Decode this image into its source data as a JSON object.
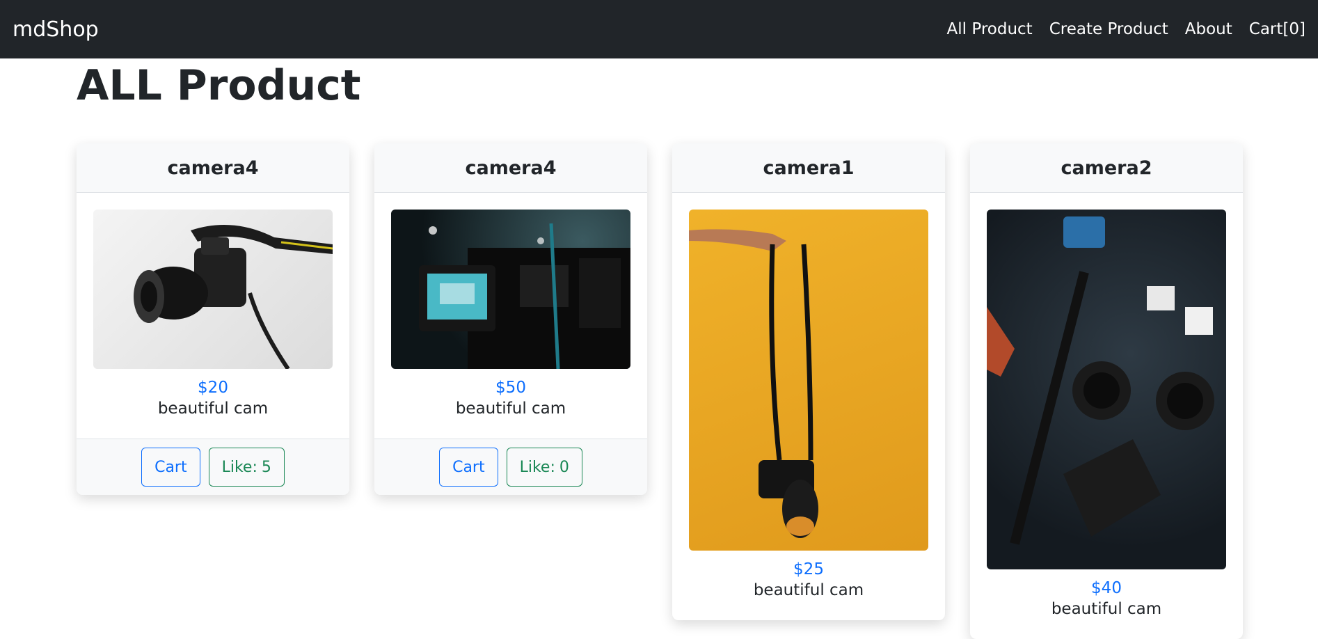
{
  "app": {
    "brand": "mdShop"
  },
  "nav": {
    "items": [
      "All Product",
      "Create Product",
      "About",
      "Cart[0]"
    ]
  },
  "page": {
    "title": "ALL Product"
  },
  "products": [
    {
      "name": "camera4",
      "price": "$20",
      "desc": "beautiful cam",
      "cart_label": "Cart",
      "like_label": "Like:",
      "like_count": "5",
      "image": "dslr-camera-with-strap"
    },
    {
      "name": "camera4",
      "price": "$50",
      "desc": "beautiful cam",
      "cart_label": "Cart",
      "like_label": "Like:",
      "like_count": "0",
      "image": "video-camcorder"
    },
    {
      "name": "camera1",
      "price": "$25",
      "desc": "beautiful cam",
      "image": "hand-holding-camera-yellow-background"
    },
    {
      "name": "camera2",
      "price": "$40",
      "desc": "beautiful cam",
      "image": "camera-lenses-flatlay"
    }
  ],
  "colors": {
    "navbar": "#212529",
    "price": "#0d6efd",
    "like": "#198754"
  }
}
